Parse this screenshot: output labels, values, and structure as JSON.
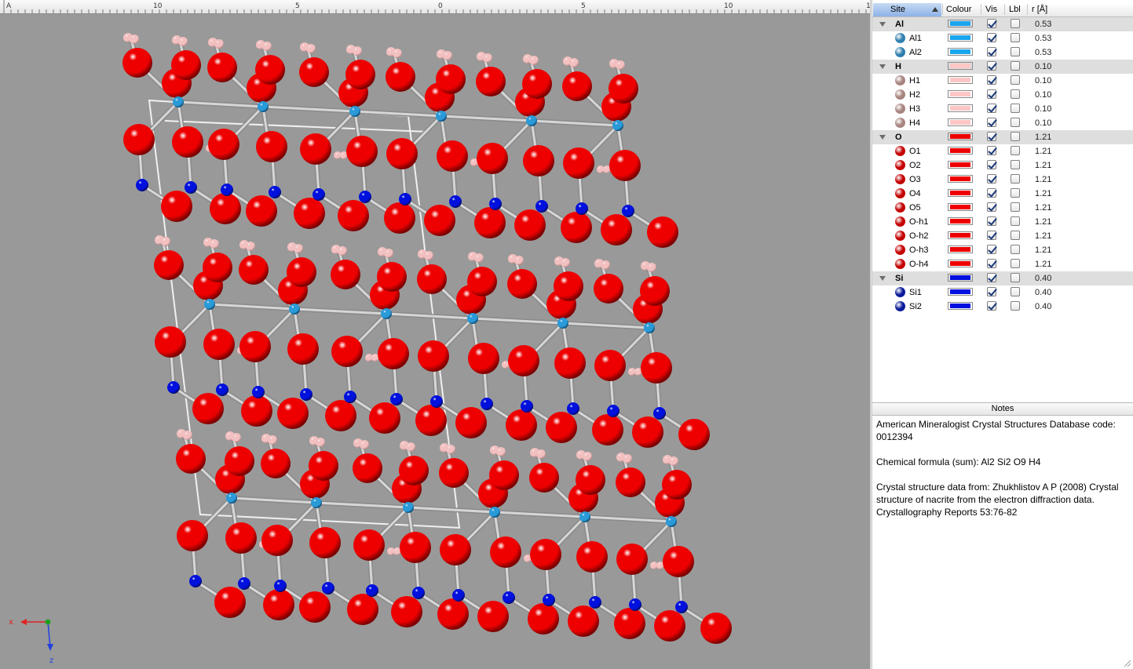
{
  "ruler": {
    "labels": [
      "A",
      "10",
      "5",
      "0",
      "5",
      "10",
      "1"
    ]
  },
  "axes": {
    "x_label": "x",
    "z_label": "z",
    "x_color": "#e02020",
    "z_color": "#2040e0",
    "origin_color": "#20a020"
  },
  "colors": {
    "background": "#999999",
    "Al": "#2a9ad8",
    "H": "#f2c0c0",
    "O": "#ee0000",
    "Si": "#0010dd",
    "bond": "#d6d6d6",
    "cell": "#f0f0f0"
  },
  "table": {
    "headers": {
      "site": "Site",
      "colour": "Colour",
      "vis": "Vis",
      "lbl": "Lbl",
      "radius": "r [Å]"
    },
    "rows": [
      {
        "type": "group",
        "label": "Al",
        "color": "#1aa6ef",
        "vis": true,
        "lbl": false,
        "r": "0.53"
      },
      {
        "type": "site",
        "label": "Al1",
        "color": "#1aa6ef",
        "dot": "#2f7fb0",
        "vis": true,
        "lbl": false,
        "r": "0.53"
      },
      {
        "type": "site",
        "label": "Al2",
        "color": "#1aa6ef",
        "dot": "#2f7fb0",
        "vis": true,
        "lbl": false,
        "r": "0.53"
      },
      {
        "type": "group",
        "label": "H",
        "color": "#ffc6c6",
        "vis": true,
        "lbl": false,
        "r": "0.10"
      },
      {
        "type": "site",
        "label": "H1",
        "color": "#ffc6c6",
        "dot": "#a8847f",
        "vis": true,
        "lbl": false,
        "r": "0.10"
      },
      {
        "type": "site",
        "label": "H2",
        "color": "#ffc6c6",
        "dot": "#a8847f",
        "vis": true,
        "lbl": false,
        "r": "0.10"
      },
      {
        "type": "site",
        "label": "H3",
        "color": "#ffc6c6",
        "dot": "#a8847f",
        "vis": true,
        "lbl": false,
        "r": "0.10"
      },
      {
        "type": "site",
        "label": "H4",
        "color": "#ffc6c6",
        "dot": "#a8847f",
        "vis": true,
        "lbl": false,
        "r": "0.10"
      },
      {
        "type": "group",
        "label": "O",
        "color": "#ee0000",
        "vis": true,
        "lbl": false,
        "r": "1.21"
      },
      {
        "type": "site",
        "label": "O1",
        "color": "#ee0000",
        "dot": "#c40000",
        "vis": true,
        "lbl": false,
        "r": "1.21"
      },
      {
        "type": "site",
        "label": "O2",
        "color": "#ee0000",
        "dot": "#c40000",
        "vis": true,
        "lbl": false,
        "r": "1.21"
      },
      {
        "type": "site",
        "label": "O3",
        "color": "#ee0000",
        "dot": "#c40000",
        "vis": true,
        "lbl": false,
        "r": "1.21"
      },
      {
        "type": "site",
        "label": "O4",
        "color": "#ee0000",
        "dot": "#c40000",
        "vis": true,
        "lbl": false,
        "r": "1.21"
      },
      {
        "type": "site",
        "label": "O5",
        "color": "#ee0000",
        "dot": "#c40000",
        "vis": true,
        "lbl": false,
        "r": "1.21"
      },
      {
        "type": "site",
        "label": "O-h1",
        "color": "#ee0000",
        "dot": "#c40000",
        "vis": true,
        "lbl": false,
        "r": "1.21"
      },
      {
        "type": "site",
        "label": "O-h2",
        "color": "#ee0000",
        "dot": "#c40000",
        "vis": true,
        "lbl": false,
        "r": "1.21"
      },
      {
        "type": "site",
        "label": "O-h3",
        "color": "#ee0000",
        "dot": "#c40000",
        "vis": true,
        "lbl": false,
        "r": "1.21"
      },
      {
        "type": "site",
        "label": "O-h4",
        "color": "#ee0000",
        "dot": "#c40000",
        "vis": true,
        "lbl": false,
        "r": "1.21"
      },
      {
        "type": "group",
        "label": "Si",
        "color": "#0010e0",
        "vis": true,
        "lbl": false,
        "r": "0.40"
      },
      {
        "type": "site",
        "label": "Si1",
        "color": "#0010e0",
        "dot": "#0a1a9a",
        "vis": true,
        "lbl": false,
        "r": "0.40"
      },
      {
        "type": "site",
        "label": "Si2",
        "color": "#0010e0",
        "dot": "#0a1a9a",
        "vis": true,
        "lbl": false,
        "r": "0.40"
      }
    ]
  },
  "notes": {
    "title": "Notes",
    "line1": "American Mineralogist Crystal Structures Database code: 0012394",
    "line2": "Chemical formula (sum): Al2 Si2 O9 H4",
    "line3": "Crystal structure data from: Zhukhlistov A P (2008) Crystal structure of nacrite from the electron diffraction data. Crystallography Reports 53:76-82"
  }
}
